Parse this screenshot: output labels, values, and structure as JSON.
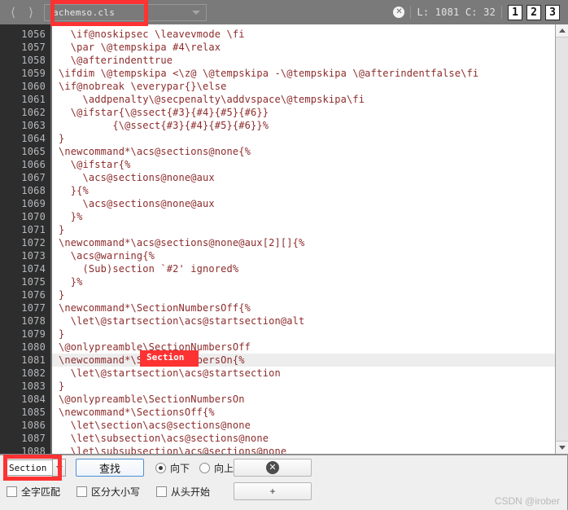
{
  "toolbar": {
    "back_icon": "chevron-left-icon",
    "forward_icon": "chevron-right-icon",
    "filename": "achemso.cls",
    "dropdown_icon": "chevron-down-icon",
    "close_icon": "close-circle-icon",
    "cursor_status": "L: 1081 C: 32",
    "view_buttons": [
      "1",
      "2",
      "3"
    ]
  },
  "editor": {
    "current_line": 1081,
    "first_line": 1056,
    "lines": [
      {
        "n": "1056",
        "text": "  \\if@noskipsec \\leavevmode \\fi"
      },
      {
        "n": "1057",
        "text": "  \\par \\@tempskipa #4\\relax"
      },
      {
        "n": "1058",
        "text": "  \\@afterindenttrue"
      },
      {
        "n": "1059",
        "text": "\\ifdim \\@tempskipa <\\z@ \\@tempskipa -\\@tempskipa \\@afterindentfalse\\fi"
      },
      {
        "n": "1060",
        "text": "\\if@nobreak \\everypar{}\\else"
      },
      {
        "n": "1061",
        "text": "    \\addpenalty\\@secpenalty\\addvspace\\@tempskipa\\fi"
      },
      {
        "n": "1062",
        "text": "  \\@ifstar{\\@ssect{#3}{#4}{#5}{#6}}"
      },
      {
        "n": "1063",
        "text": "         {\\@ssect{#3}{#4}{#5}{#6}}%"
      },
      {
        "n": "1064",
        "text": "}"
      },
      {
        "n": "1065",
        "text": "\\newcommand*\\acs@sections@none{%"
      },
      {
        "n": "1066",
        "text": "  \\@ifstar{%"
      },
      {
        "n": "1067",
        "text": "    \\acs@sections@none@aux"
      },
      {
        "n": "1068",
        "text": "  }{%"
      },
      {
        "n": "1069",
        "text": "    \\acs@sections@none@aux"
      },
      {
        "n": "1070",
        "text": "  }%"
      },
      {
        "n": "1071",
        "text": "}"
      },
      {
        "n": "1072",
        "text": "\\newcommand*\\acs@sections@none@aux[2][]{%"
      },
      {
        "n": "1073",
        "text": "  \\acs@warning{%"
      },
      {
        "n": "1074",
        "text": "    (Sub)section `#2' ignored%"
      },
      {
        "n": "1075",
        "text": "  }%"
      },
      {
        "n": "1076",
        "text": "}"
      },
      {
        "n": "1077",
        "text": "\\newcommand*\\SectionNumbersOff{%"
      },
      {
        "n": "1078",
        "text": "  \\let\\@startsection\\acs@startsection@alt"
      },
      {
        "n": "1079",
        "text": "}"
      },
      {
        "n": "1080",
        "text": "\\@onlypreamble\\SectionNumbersOff"
      },
      {
        "n": "1081",
        "text": "\\newcommand*\\SectionNumbersOn{%"
      },
      {
        "n": "1082",
        "text": "  \\let\\@startsection\\acs@startsection"
      },
      {
        "n": "1083",
        "text": "}"
      },
      {
        "n": "1084",
        "text": "\\@onlypreamble\\SectionNumbersOn"
      },
      {
        "n": "1085",
        "text": "\\newcommand*\\SectionsOff{%"
      },
      {
        "n": "1086",
        "text": "  \\let\\section\\acs@sections@none"
      },
      {
        "n": "1087",
        "text": "  \\let\\subsection\\acs@sections@none"
      },
      {
        "n": "1088",
        "text": "  \\let\\subsubsection\\acs@sections@none"
      }
    ],
    "scroll_up_icon": "arrow-up-icon",
    "scroll_down_icon": "arrow-down-icon"
  },
  "findbar": {
    "search_value": "Section",
    "search_placeholder": "",
    "history_dropdown_icon": "chevron-down-icon",
    "find_button": "查找",
    "direction_down": "向下",
    "direction_up": "向上",
    "direction_selected": "向下",
    "whole_word": "全字匹配",
    "case_sensitive": "区分大小写",
    "from_start": "从头开始",
    "close_button_icon": "close-circle-icon",
    "plus_button": "+",
    "watermark": "CSDN @irober"
  },
  "annotations": {
    "accent_color": "#fd3232",
    "boxes": [
      {
        "name": "filename-highlight"
      },
      {
        "name": "code-match-highlight",
        "text": "Section"
      },
      {
        "name": "search-field-highlight"
      }
    ]
  }
}
